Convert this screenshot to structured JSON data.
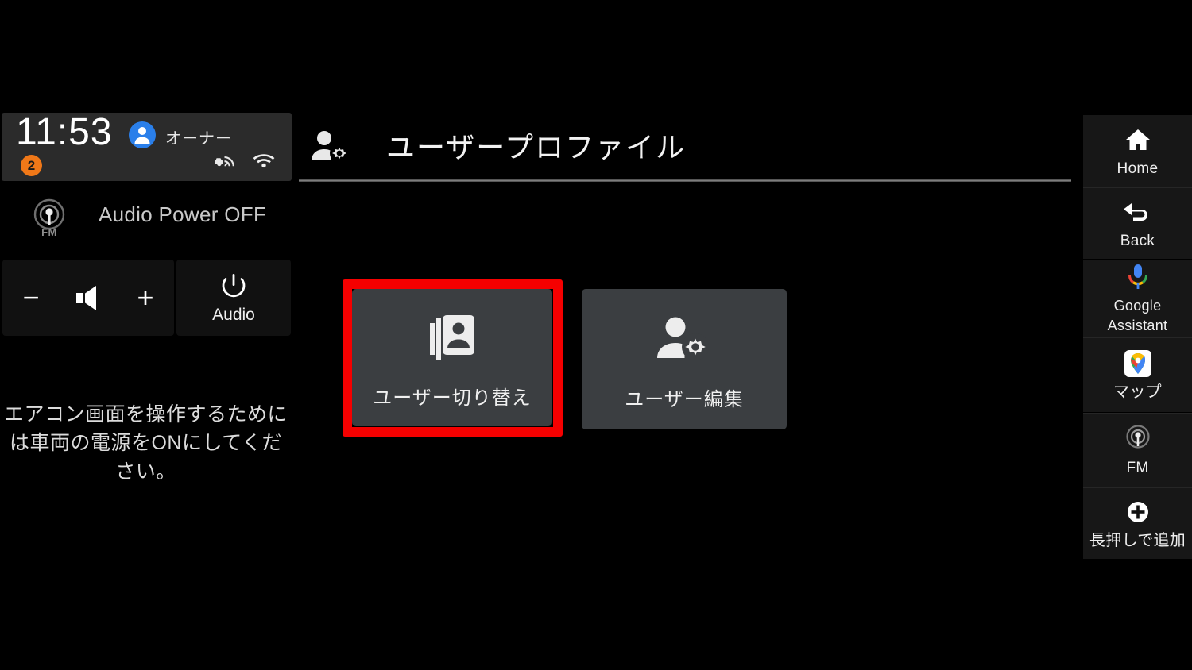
{
  "status_bar": {
    "time": "11:53",
    "user_name": "オーナー",
    "notification_count": "2",
    "avatar_icon": "person-avatar-icon",
    "vehicle_connection_icon": "car-connectivity-icon",
    "wifi_icon": "wifi-icon",
    "accent_blue": "#2a7fea",
    "badge_orange": "#f07818",
    "panel_bg": "#2b2b2b"
  },
  "audio": {
    "status_text": "Audio Power OFF",
    "source_icon": "fm-radio-icon",
    "source_icon_label": "FM",
    "volume_down_label": "−",
    "volume_up_label": "+",
    "volume_icon": "speaker-volume-icon",
    "power_icon": "power-icon",
    "power_label": "Audio"
  },
  "climate_message": "エアコン画面を操作するためには車両の電源をONにしてください。",
  "header": {
    "icon": "user-settings-icon",
    "title": "ユーザープロファイル"
  },
  "main": {
    "tiles": [
      {
        "label": "ユーザー切り替え",
        "icon": "switch-account-icon",
        "highlighted": true
      },
      {
        "label": "ユーザー編集",
        "icon": "manage-accounts-icon",
        "highlighted": false
      }
    ],
    "highlight_color": "#f50000",
    "tile_bg": "#3b3e41"
  },
  "sidebar": {
    "items": [
      {
        "label": "Home",
        "icon": "home-icon"
      },
      {
        "label": "Back",
        "icon": "back-arrow-icon"
      },
      {
        "label": "Google Assistant",
        "icon": "google-assistant-mic-icon"
      },
      {
        "label": "マップ",
        "icon": "google-maps-icon"
      },
      {
        "label": "FM",
        "icon": "fm-radio-icon"
      },
      {
        "label": "長押しで追加",
        "icon": "plus-circle-icon"
      }
    ]
  }
}
